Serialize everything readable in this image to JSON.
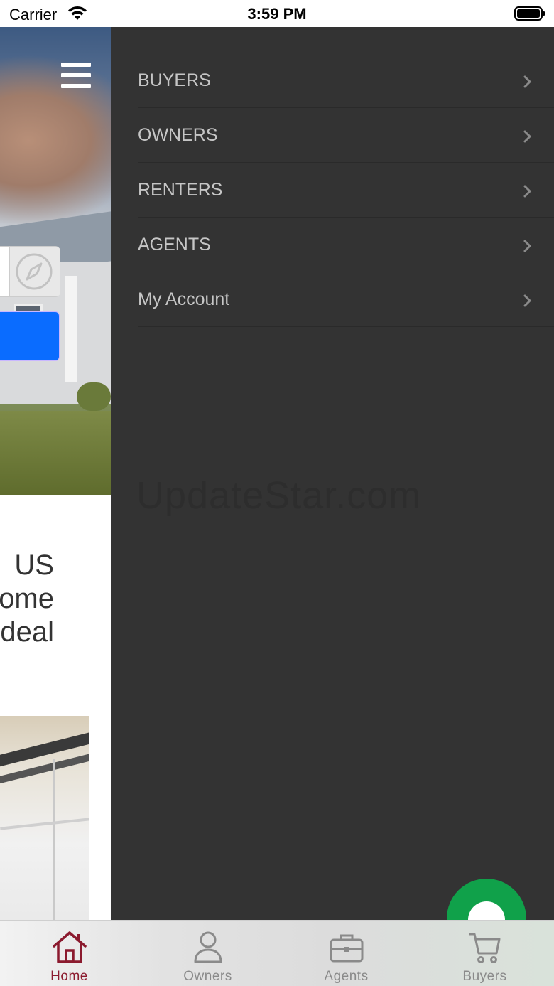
{
  "status_bar": {
    "carrier": "Carrier",
    "time": "3:59 PM"
  },
  "background_page": {
    "headline_lines": [
      "US",
      "ome",
      "deal"
    ]
  },
  "drawer": {
    "items": [
      {
        "label": "BUYERS"
      },
      {
        "label": "OWNERS"
      },
      {
        "label": "RENTERS"
      },
      {
        "label": "AGENTS"
      },
      {
        "label": "My Account"
      }
    ],
    "watermark": "UpdateStar.com"
  },
  "tab_bar": {
    "tabs": [
      {
        "label": "Home",
        "icon": "home-icon",
        "active": true
      },
      {
        "label": "Owners",
        "icon": "person-icon",
        "active": false
      },
      {
        "label": "Agents",
        "icon": "briefcase-icon",
        "active": false
      },
      {
        "label": "Buyers",
        "icon": "cart-icon",
        "active": false
      }
    ]
  },
  "colors": {
    "drawer_bg": "#333333",
    "active_tab": "#8b1a2e",
    "inactive_tab": "#8a8a8a",
    "search_button": "#0a6cff",
    "chat_button": "#10a14a"
  }
}
